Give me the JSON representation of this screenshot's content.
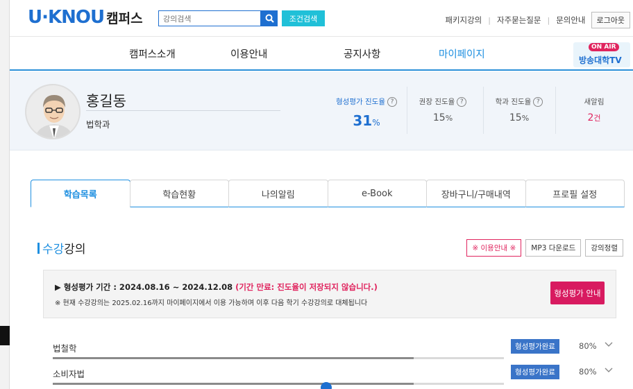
{
  "header": {
    "logo_main": "U·KNOU",
    "logo_sub": "캠퍼스",
    "search_placeholder": "강의검색",
    "advanced_search": "조건검색",
    "util_links": [
      "패키지강의",
      "자주묻는질문",
      "문의안내"
    ],
    "logout": "로그아웃"
  },
  "nav": {
    "items": [
      "캠퍼스소개",
      "이용안내",
      "공지사항",
      "마이페이지"
    ],
    "active": "마이페이지",
    "onair_badge": "ON AIR",
    "onair_label": "방송대학TV"
  },
  "profile": {
    "name": "홍길동",
    "department": "법학과",
    "stats": [
      {
        "label": "형성평가 진도율",
        "value": "31",
        "unit": "%"
      },
      {
        "label": "권장 진도율",
        "value": "15",
        "unit": "%"
      },
      {
        "label": "학과 진도율",
        "value": "15",
        "unit": "%"
      },
      {
        "label": "새알림",
        "value": "2",
        "unit": "건"
      }
    ]
  },
  "tabs": [
    "학습목록",
    "학습현황",
    "나의알림",
    "e-Book",
    "장바구니/구매내역",
    "프로필 설정"
  ],
  "section": {
    "title_hl": "수강",
    "title_rest": "강의",
    "buttons": [
      "※ 이용안내 ※",
      "MP3 다운로드",
      "강의정렬"
    ]
  },
  "notice": {
    "period_label": "▶ 형성평가 기간 : 2024.08.16 ~ 2024.12.08 ",
    "period_warn": "(기간 만료: 진도율이 저장되지 않습니다.)",
    "sub": "※ 현재 수강강의는 2025.02.16까지 마이페이지에서 이용 가능하며 이후 다음 학기 수강강의로 대체됩니다",
    "button": "형성평가 안내"
  },
  "courses": [
    {
      "name": "법철학",
      "status": "형성평가완료",
      "progress": "80%",
      "progress_fraction": 0.8
    },
    {
      "name": "소비자법",
      "status": "형성평가완료",
      "progress": "80%",
      "progress_fraction": 0.8
    }
  ]
}
